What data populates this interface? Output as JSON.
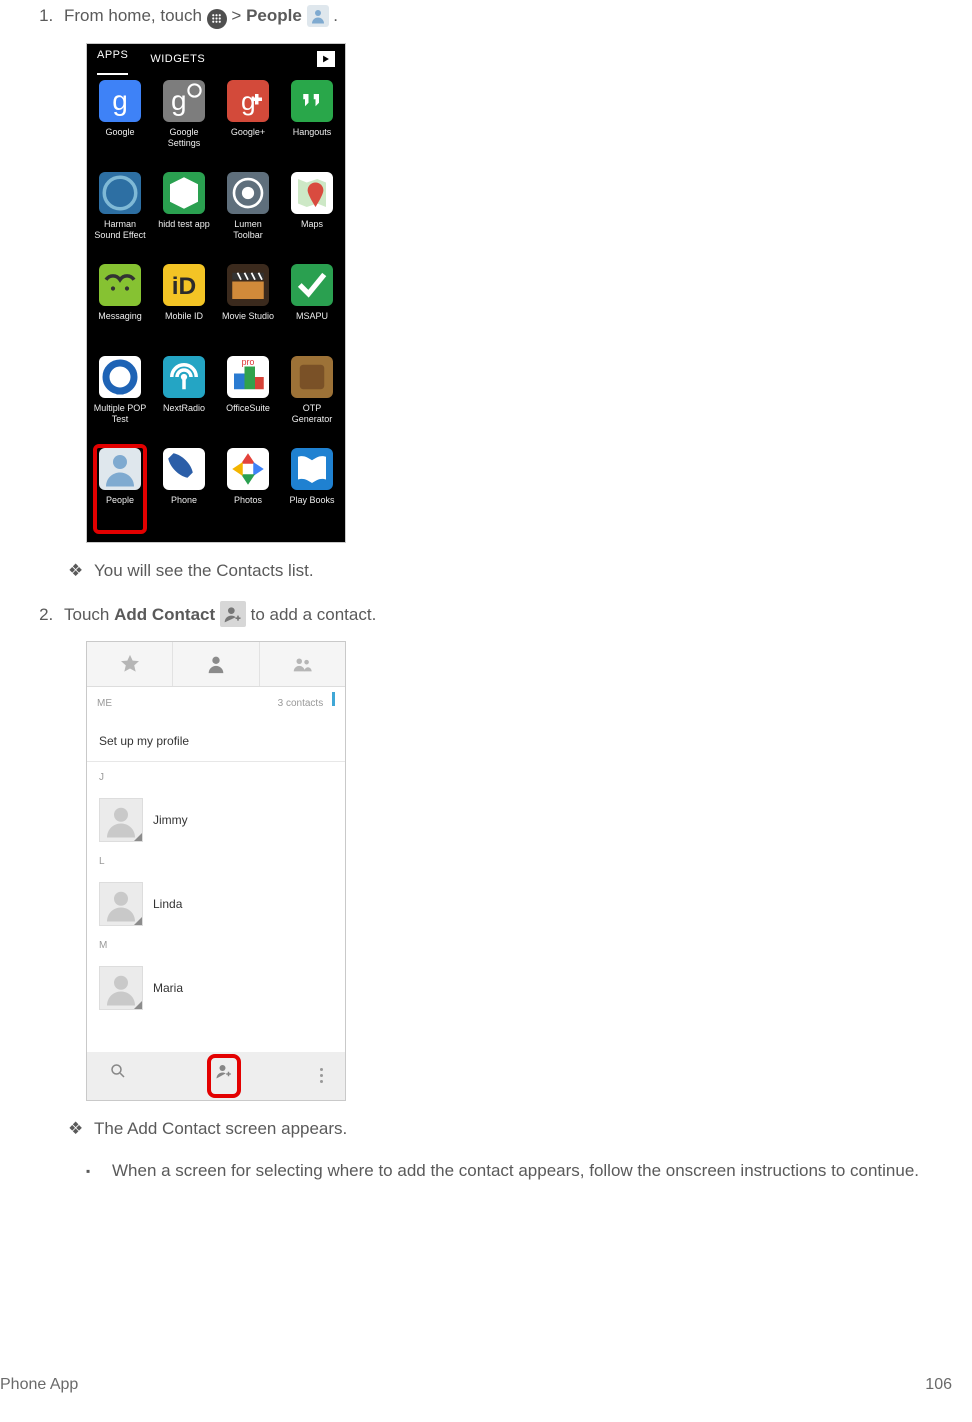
{
  "step1": {
    "prefix": "From home, touch ",
    "sep": " > ",
    "bold": "People",
    "suffix": "."
  },
  "apps_tab": "APPS",
  "widgets_tab": "WIDGETS",
  "app_grid": [
    [
      {
        "label": "Google",
        "bg": "#3e82f7",
        "kind": "google"
      },
      {
        "label": "Google Settings",
        "bg": "#7d7d7d",
        "kind": "google-settings"
      },
      {
        "label": "Google+",
        "bg": "#d34a3a",
        "kind": "gplus"
      },
      {
        "label": "Hangouts",
        "bg": "#29a74a",
        "kind": "hangouts"
      }
    ],
    [
      {
        "label": "Harman Sound Effect",
        "bg": "#2d6fa3",
        "kind": "harman"
      },
      {
        "label": "hidd test app",
        "bg": "#2aa050",
        "kind": "box"
      },
      {
        "label": "Lumen Toolbar",
        "bg": "#5f6f7c",
        "kind": "lumen"
      },
      {
        "label": "Maps",
        "bg": "#ffffff",
        "kind": "maps"
      }
    ],
    [
      {
        "label": "Messaging",
        "bg": "#86c232",
        "kind": "messaging"
      },
      {
        "label": "Mobile ID",
        "bg": "#f3c425",
        "kind": "mobileid"
      },
      {
        "label": "Movie Studio",
        "bg": "#3b2a1d",
        "kind": "clap"
      },
      {
        "label": "MSAPU",
        "bg": "#2aa050",
        "kind": "check"
      }
    ],
    [
      {
        "label": "Multiple POP Test",
        "bg": "#ffffff",
        "kind": "pop"
      },
      {
        "label": "NextRadio",
        "bg": "#24a5c4",
        "kind": "radio"
      },
      {
        "label": "OfficeSuite",
        "bg": "#ffffff",
        "kind": "office"
      },
      {
        "label": "OTP Generator",
        "bg": "#9d7237",
        "kind": "otp"
      }
    ],
    [
      {
        "label": "People",
        "bg": "#dfe7ed",
        "kind": "people",
        "highlight": true
      },
      {
        "label": "Phone",
        "bg": "#ffffff",
        "kind": "phone"
      },
      {
        "label": "Photos",
        "bg": "#ffffff",
        "kind": "photos"
      },
      {
        "label": "Play Books",
        "bg": "#1f81d1",
        "kind": "books"
      }
    ]
  ],
  "bullet1": "You will see the Contacts list.",
  "step2": {
    "prefix": "Touch ",
    "bold": "Add Contact",
    "suffix": " to add a contact."
  },
  "contacts_shot": {
    "me": "ME",
    "count": "3 contacts",
    "profile": "Set up my profile",
    "sections": [
      {
        "letter": "J",
        "name": "Jimmy"
      },
      {
        "letter": "L",
        "name": "Linda"
      },
      {
        "letter": "M",
        "name": "Maria"
      }
    ]
  },
  "bullet2": "The Add Contact screen appears.",
  "sub_bullet": "When a screen for selecting where to add the contact appears, follow the onscreen instructions to continue.",
  "footer_left": "Phone App",
  "footer_right": "106"
}
